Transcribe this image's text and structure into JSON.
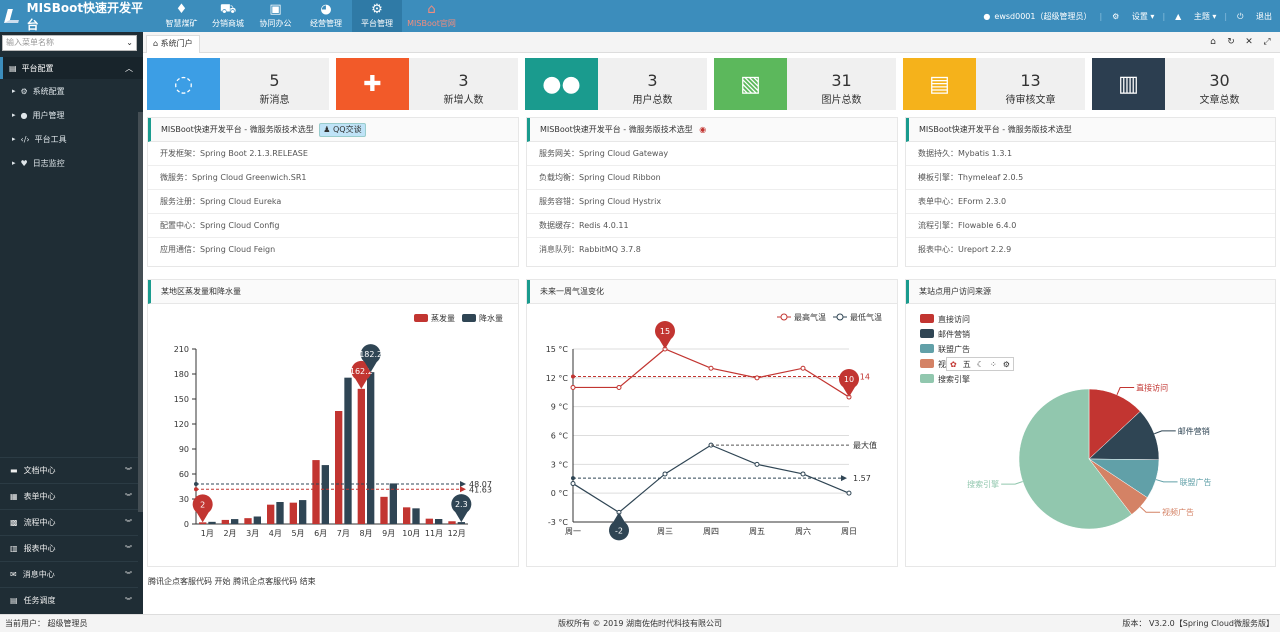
{
  "app": {
    "title": "MISBoot快速开发平台"
  },
  "nav": [
    {
      "label": "智慧煤矿",
      "icon": "diamond-icon"
    },
    {
      "label": "分销商城",
      "icon": "cart-icon"
    },
    {
      "label": "协同办公",
      "icon": "briefcase-icon"
    },
    {
      "label": "经营管理",
      "icon": "dashboard-icon"
    },
    {
      "label": "平台管理",
      "icon": "gear-icon"
    },
    {
      "label": "MISBoot官网",
      "icon": "home-icon"
    }
  ],
  "topright": {
    "user": "ewsd0001（超级管理员）",
    "settings": "设置",
    "theme": "主题",
    "logout": "退出"
  },
  "sidebar": {
    "search_placeholder": "输入菜单名称",
    "group": "平台配置",
    "items": [
      "系统配置",
      "用户管理",
      "平台工具",
      "日志监控"
    ],
    "bottom": [
      "文档中心",
      "表单中心",
      "流程中心",
      "报表中心",
      "消息中心",
      "任务调度"
    ]
  },
  "tabs": {
    "home": "系统门户"
  },
  "stats": [
    {
      "num": "5",
      "label": "新消息",
      "color": "#3c9ee5",
      "icon": "chat-icon"
    },
    {
      "num": "3",
      "label": "新增人数",
      "color": "#f25a29",
      "icon": "add-user-icon"
    },
    {
      "num": "3",
      "label": "用户总数",
      "color": "#1a9b8e",
      "icon": "users-icon"
    },
    {
      "num": "31",
      "label": "图片总数",
      "color": "#5cb85c",
      "icon": "image-icon"
    },
    {
      "num": "13",
      "label": "待审核文章",
      "color": "#f5b21b",
      "icon": "document-icon"
    },
    {
      "num": "30",
      "label": "文章总数",
      "color": "#2c3e50",
      "icon": "files-icon"
    }
  ],
  "panels": [
    {
      "title": "MISBoot快速开发平台 - 微服务版技术选型",
      "badge": "QQ交谈",
      "rows": [
        "开发框架：Spring Boot 2.1.3.RELEASE",
        "微服务：Spring Cloud Greenwich.SR1",
        "服务注册：Spring Cloud Eureka",
        "配置中心：Spring Cloud Config",
        "应用通信：Spring Cloud Feign"
      ]
    },
    {
      "title": "MISBoot快速开发平台 - 微服务版技术选型",
      "badge": "",
      "rows": [
        "服务网关：Spring Cloud Gateway",
        "负载均衡：Spring Cloud Ribbon",
        "服务容错：Spring Cloud Hystrix",
        "数据缓存：Redis 4.0.11",
        "消息队列：RabbitMQ 3.7.8"
      ]
    },
    {
      "title": "MISBoot快速开发平台 - 微服务版技术选型",
      "badge": "",
      "rows": [
        "数据持久：Mybatis 1.3.1",
        "模板引擎：Thymeleaf 2.0.5",
        "表单中心：EForm 2.3.0",
        "流程引擎：Flowable 6.4.0",
        "报表中心：Ureport 2.2.9"
      ]
    }
  ],
  "chart_titles": [
    "某地区蒸发量和降水量",
    "未来一周气温变化",
    "某站点用户访问来源"
  ],
  "chart_data": [
    {
      "type": "bar",
      "categories": [
        "1月",
        "2月",
        "3月",
        "4月",
        "5月",
        "6月",
        "7月",
        "8月",
        "9月",
        "10月",
        "11月",
        "12月"
      ],
      "series": [
        {
          "name": "蒸发量",
          "color": "#c23531",
          "values": [
            2.0,
            4.9,
            7.0,
            23.2,
            25.6,
            76.7,
            135.6,
            162.2,
            32.6,
            20.0,
            6.4,
            3.3
          ]
        },
        {
          "name": "降水量",
          "color": "#2f4554",
          "values": [
            2.6,
            5.9,
            9.0,
            26.4,
            28.7,
            70.7,
            175.6,
            182.2,
            48.7,
            18.8,
            6.0,
            2.3
          ]
        }
      ],
      "ylim": [
        0,
        210
      ],
      "yticks": [
        "0",
        "30",
        "60",
        "90",
        "120",
        "150",
        "180",
        "210"
      ],
      "markpoints": [
        "2",
        "162.2",
        "182.2",
        "2.3"
      ],
      "marklines": [
        "48.07",
        "41.63"
      ],
      "legend": "top-right"
    },
    {
      "type": "line",
      "categories": [
        "周一",
        "周二",
        "周三",
        "周四",
        "周五",
        "周六",
        "周日"
      ],
      "series": [
        {
          "name": "最高气温",
          "color": "#c23531",
          "values": [
            11,
            11,
            15,
            13,
            12,
            13,
            10
          ]
        },
        {
          "name": "最低气温",
          "color": "#2f4554",
          "values": [
            1,
            -2,
            2,
            5,
            3,
            2,
            0
          ]
        }
      ],
      "ylim": [
        -3,
        15
      ],
      "yticks": [
        "-3 °C",
        "0 °C",
        "3 °C",
        "6 °C",
        "9 °C",
        "12 °C",
        "15 °C"
      ],
      "markpoints": [
        "15",
        "10",
        "-2"
      ],
      "marklines": [
        "12.14",
        "最大值",
        "1.57"
      ],
      "legend": "top-right"
    },
    {
      "type": "pie",
      "series": [
        {
          "name": "",
          "values": [
            {
              "name": "直接访问",
              "value": 335,
              "color": "#c23531"
            },
            {
              "name": "邮件营销",
              "value": 310,
              "color": "#2f4554"
            },
            {
              "name": "联盟广告",
              "value": 234,
              "color": "#61a0a8"
            },
            {
              "name": "视频广告",
              "value": 135,
              "color": "#d48265"
            },
            {
              "name": "搜索引擎",
              "value": 1548,
              "color": "#91c7ae"
            }
          ]
        }
      ],
      "legend": "top-left"
    }
  ],
  "tooltip_toolbar": "五",
  "footer_note": "腾讯企点客服代码 开始 腾讯企点客服代码 结束",
  "bottombar": {
    "left": "当前用户： 超级管理员",
    "center": "版权所有 © 2019 湖南佐佑时代科技有限公司",
    "right": "版本： V3.2.0【Spring Cloud微服务版】"
  }
}
